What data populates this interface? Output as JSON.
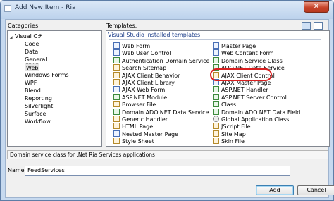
{
  "window": {
    "title": "Add New Item - Ria",
    "close_glyph": "✕"
  },
  "categories": {
    "label_prefix": "",
    "label": "Categories:",
    "tree": [
      {
        "label": "Visual C#",
        "level": 0,
        "expanded": true
      },
      {
        "label": "Code",
        "level": 1
      },
      {
        "label": "Data",
        "level": 1
      },
      {
        "label": "General",
        "level": 1
      },
      {
        "label": "Web",
        "level": 1,
        "selected": true
      },
      {
        "label": "Windows Forms",
        "level": 1
      },
      {
        "label": "WPF",
        "level": 1
      },
      {
        "label": "Blend",
        "level": 1
      },
      {
        "label": "Reporting",
        "level": 1
      },
      {
        "label": "Silverlight",
        "level": 1
      },
      {
        "label": "Surface",
        "level": 1
      },
      {
        "label": "Workflow",
        "level": 1
      }
    ]
  },
  "templates": {
    "label": "Templates:",
    "group_header": "Visual Studio installed templates",
    "left_column": [
      {
        "label": "Web Form",
        "icon": "aspx"
      },
      {
        "label": "Web User Control",
        "icon": "aspx"
      },
      {
        "label": "Authentication Domain Service",
        "icon": "cs"
      },
      {
        "label": "Search Sitemap",
        "icon": "web"
      },
      {
        "label": "AJAX Client Behavior",
        "icon": "web"
      },
      {
        "label": "AJAX Client Library",
        "icon": "web"
      },
      {
        "label": "AJAX Web Form",
        "icon": "aspx"
      },
      {
        "label": "ASP.NET Module",
        "icon": "cs"
      },
      {
        "label": "Browser File",
        "icon": "web"
      },
      {
        "label": "Domain ADO.NET Data Service",
        "icon": "cs"
      },
      {
        "label": "Generic Handler",
        "icon": "web"
      },
      {
        "label": "HTML Page",
        "icon": "web"
      },
      {
        "label": "Nested Master Page",
        "icon": "aspx"
      },
      {
        "label": "Style Sheet",
        "icon": "web"
      }
    ],
    "right_column": [
      {
        "label": "Master Page",
        "icon": "aspx"
      },
      {
        "label": "Web Content Form",
        "icon": "aspx"
      },
      {
        "label": "Domain Service Class",
        "icon": "cs",
        "highlighted": true
      },
      {
        "label": "ADO.NET Data Service",
        "icon": "cs"
      },
      {
        "label": "AJAX Client Control",
        "icon": "web"
      },
      {
        "label": "AJAX Master Page",
        "icon": "aspx"
      },
      {
        "label": "ASP.NET Handler",
        "icon": "cs"
      },
      {
        "label": "ASP.NET Server Control",
        "icon": "cs"
      },
      {
        "label": "Class",
        "icon": "cs"
      },
      {
        "label": "Domain ADO.NET Data Field",
        "icon": "cs"
      },
      {
        "label": "Global Application Class",
        "icon": "gear"
      },
      {
        "label": "JScript File",
        "icon": "web"
      },
      {
        "label": "Site Map",
        "icon": "web"
      },
      {
        "label": "Skin File",
        "icon": "web"
      }
    ]
  },
  "description": "Domain service class for .Net Ria Services applications",
  "name_field": {
    "label_underlined": "N",
    "label_rest": "ame:",
    "value": "FeedServices"
  },
  "buttons": {
    "add": "Add",
    "cancel": "Cancel"
  }
}
